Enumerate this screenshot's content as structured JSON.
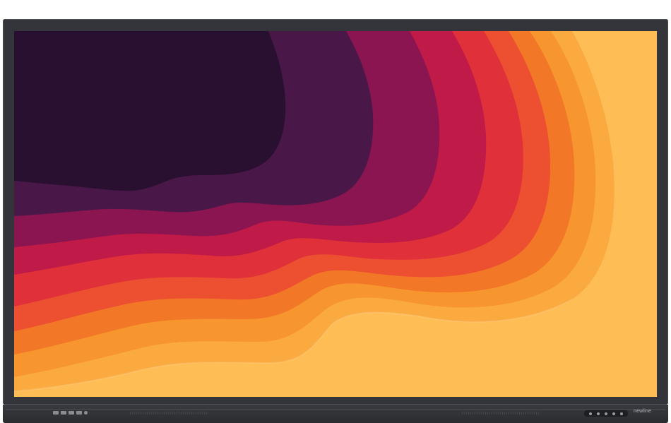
{
  "device": {
    "brand_logo": "newline",
    "type": "interactive-display"
  },
  "wallpaper": {
    "style": "layered-paper-waves",
    "colors": {
      "deep_plum": "#2a1030",
      "purple": "#4a1848",
      "magenta": "#8a1550",
      "crimson": "#c01a48",
      "red": "#e0303a",
      "red_orange": "#ec5030",
      "orange": "#f27828",
      "light_orange": "#f7962e",
      "amber": "#fbaa40",
      "pale_yellow": "#ffbd56"
    }
  },
  "front_panel": {
    "ports": [
      "usb-c-port",
      "hdmi-port",
      "usb-a-port",
      "usb-a-port",
      "audio-port"
    ],
    "control_buttons": [
      "power-button",
      "input-button",
      "volume-down-button",
      "volume-up-button",
      "menu-button"
    ]
  }
}
